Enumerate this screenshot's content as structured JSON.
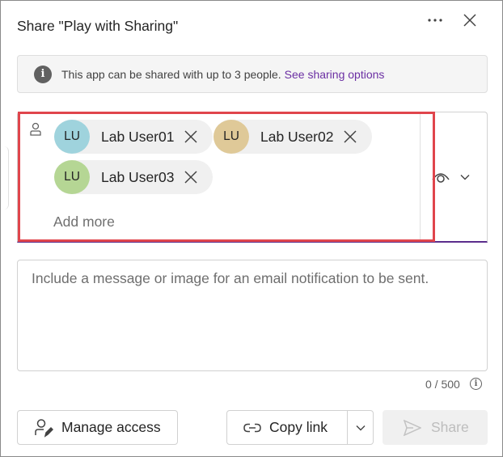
{
  "dialog": {
    "title": "Share \"Play with Sharing\"",
    "more_icon": "more-horizontal-icon",
    "close_icon": "close-icon"
  },
  "info_bar": {
    "icon": "info-icon",
    "text": "This app can be shared with up to 3 people.",
    "link": "See sharing options",
    "link_color": "#6b2fa3"
  },
  "people": {
    "icon": "person-icon",
    "chips": [
      {
        "initials": "LU",
        "name": "Lab User01",
        "avatar_color": "#9fd3dd"
      },
      {
        "initials": "LU",
        "name": "Lab User02",
        "avatar_color": "#dfc998"
      },
      {
        "initials": "LU",
        "name": "Lab User03",
        "avatar_color": "#b5d694"
      }
    ],
    "add_more_placeholder": "Add more",
    "permission_icon": "eye-icon",
    "highlight_color": "#e0454c",
    "focus_underline_color": "#5b2d8c"
  },
  "message": {
    "placeholder": "Include a message or image for an email notification to be sent.",
    "char_count": "0 / 500"
  },
  "footer": {
    "manage_access": "Manage access",
    "copy_link": "Copy link",
    "share": "Share"
  }
}
